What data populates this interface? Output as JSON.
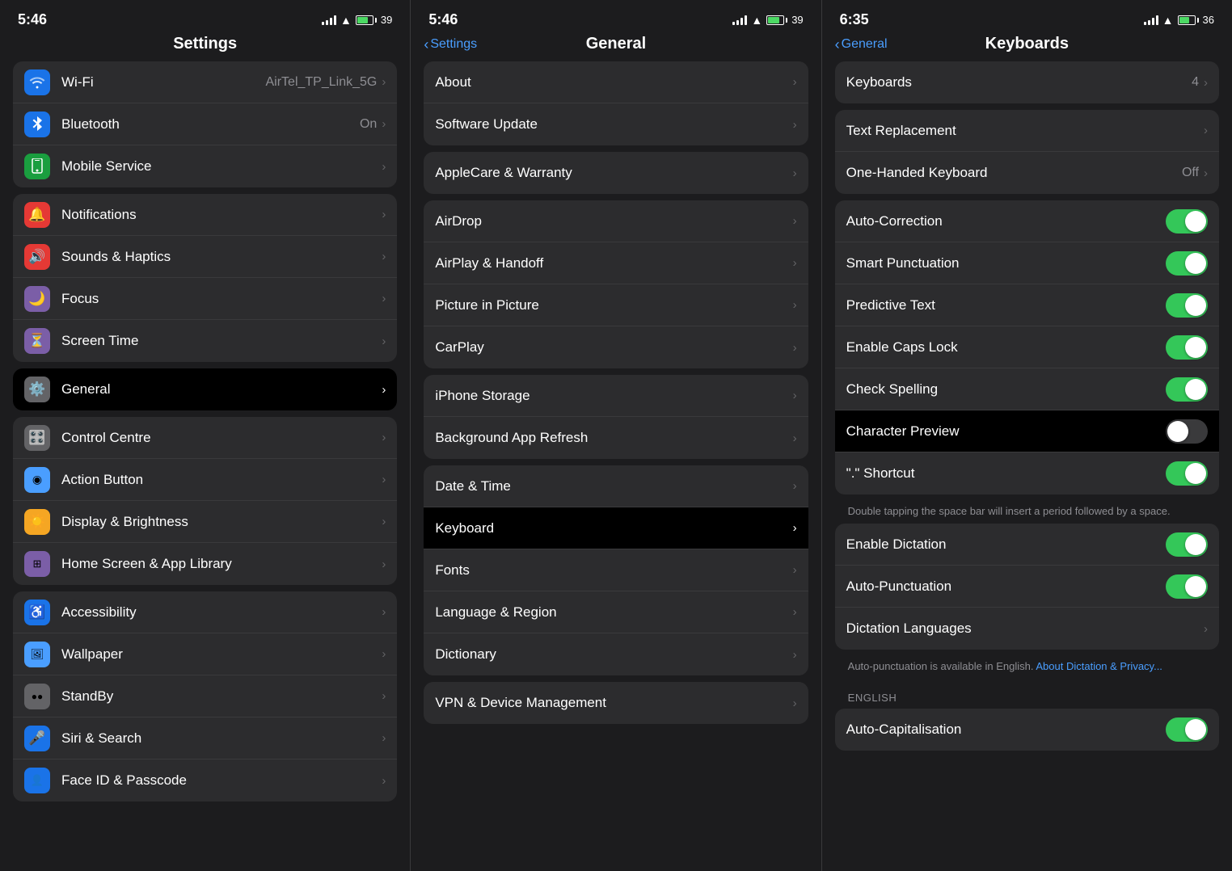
{
  "panel1": {
    "statusTime": "5:46",
    "title": "Settings",
    "rows": [
      {
        "id": "wifi",
        "icon": "📶",
        "iconBg": "#1a73e8",
        "label": "Wi-Fi",
        "value": "AirTel_TP_Link_5G",
        "chevron": true
      },
      {
        "id": "bluetooth",
        "icon": "🔵",
        "iconBg": "#1a73e8",
        "label": "Bluetooth",
        "value": "On",
        "chevron": true
      },
      {
        "id": "mobile",
        "icon": "📱",
        "iconBg": "#1a9e3f",
        "label": "Mobile Service",
        "value": "",
        "chevron": true
      },
      {
        "id": "notifications",
        "icon": "🔔",
        "iconBg": "#e53935",
        "label": "Notifications",
        "value": "",
        "chevron": true
      },
      {
        "id": "sounds",
        "icon": "🔊",
        "iconBg": "#e53935",
        "label": "Sounds & Haptics",
        "value": "",
        "chevron": true
      },
      {
        "id": "focus",
        "icon": "🌙",
        "iconBg": "#7b5ea7",
        "label": "Focus",
        "value": "",
        "chevron": true
      },
      {
        "id": "screentime",
        "icon": "⏳",
        "iconBg": "#7b5ea7",
        "label": "Screen Time",
        "value": "",
        "chevron": true
      },
      {
        "id": "general",
        "icon": "⚙️",
        "iconBg": "#636366",
        "label": "General",
        "value": "",
        "chevron": true,
        "selected": true
      },
      {
        "id": "controlcentre",
        "icon": "🎛️",
        "iconBg": "#636366",
        "label": "Control Centre",
        "value": "",
        "chevron": true
      },
      {
        "id": "actionbutton",
        "icon": "🔘",
        "iconBg": "#4a9eff",
        "label": "Action Button",
        "value": "",
        "chevron": true
      },
      {
        "id": "display",
        "icon": "☀️",
        "iconBg": "#f5a623",
        "label": "Display & Brightness",
        "value": "",
        "chevron": true
      },
      {
        "id": "homescreen",
        "icon": "📱",
        "iconBg": "#7b5ea7",
        "label": "Home Screen & App Library",
        "value": "",
        "chevron": true
      },
      {
        "id": "accessibility",
        "icon": "♿",
        "iconBg": "#1a73e8",
        "label": "Accessibility",
        "value": "",
        "chevron": true
      },
      {
        "id": "wallpaper",
        "icon": "🖼️",
        "iconBg": "#4a9eff",
        "label": "Wallpaper",
        "value": "",
        "chevron": true
      },
      {
        "id": "standby",
        "icon": "🌙",
        "iconBg": "#636366",
        "label": "StandBy",
        "value": "",
        "chevron": true
      },
      {
        "id": "siri",
        "icon": "🎤",
        "iconBg": "#1a73e8",
        "label": "Siri & Search",
        "value": "",
        "chevron": true
      },
      {
        "id": "faceid",
        "icon": "👤",
        "iconBg": "#1a73e8",
        "label": "Face ID & Passcode",
        "value": "",
        "chevron": true
      }
    ]
  },
  "panel2": {
    "statusTime": "5:46",
    "backLabel": "Settings",
    "title": "General",
    "sections": [
      {
        "rows": [
          {
            "id": "about",
            "label": "About",
            "chevron": true
          },
          {
            "id": "softwareupdate",
            "label": "Software Update",
            "chevron": true
          }
        ]
      },
      {
        "rows": [
          {
            "id": "applecare",
            "label": "AppleCare & Warranty",
            "chevron": true
          }
        ]
      },
      {
        "rows": [
          {
            "id": "airdrop",
            "label": "AirDrop",
            "chevron": true
          },
          {
            "id": "airplay",
            "label": "AirPlay & Handoff",
            "chevron": true
          },
          {
            "id": "pictureinpicture",
            "label": "Picture in Picture",
            "chevron": true
          },
          {
            "id": "carplay",
            "label": "CarPlay",
            "chevron": true
          }
        ]
      },
      {
        "rows": [
          {
            "id": "iphonestorage",
            "label": "iPhone Storage",
            "chevron": true
          },
          {
            "id": "backgroundapprefresh",
            "label": "Background App Refresh",
            "chevron": true
          }
        ]
      },
      {
        "rows": [
          {
            "id": "datetime",
            "label": "Date & Time",
            "chevron": true
          },
          {
            "id": "keyboard",
            "label": "Keyboard",
            "chevron": true,
            "selected": true
          },
          {
            "id": "fonts",
            "label": "Fonts",
            "chevron": true
          },
          {
            "id": "languageregion",
            "label": "Language & Region",
            "chevron": true
          },
          {
            "id": "dictionary",
            "label": "Dictionary",
            "chevron": true
          }
        ]
      },
      {
        "rows": [
          {
            "id": "vpn",
            "label": "VPN & Device Management",
            "chevron": true
          }
        ]
      }
    ]
  },
  "panel3": {
    "statusTime": "6:35",
    "backLabel": "General",
    "title": "Keyboards",
    "sections": [
      {
        "rows": [
          {
            "id": "keyboards",
            "label": "Keyboards",
            "value": "4",
            "chevron": true
          }
        ]
      },
      {
        "rows": [
          {
            "id": "textreplacement",
            "label": "Text Replacement",
            "chevron": true
          },
          {
            "id": "onehandedkeyboard",
            "label": "One-Handed Keyboard",
            "value": "Off",
            "chevron": true
          }
        ]
      },
      {
        "rows": [
          {
            "id": "autocorrection",
            "label": "Auto-Correction",
            "toggle": true,
            "toggleOn": true
          },
          {
            "id": "smartpunctuation",
            "label": "Smart Punctuation",
            "toggle": true,
            "toggleOn": true
          },
          {
            "id": "predictivetext",
            "label": "Predictive Text",
            "toggle": true,
            "toggleOn": true
          },
          {
            "id": "enablecapslock",
            "label": "Enable Caps Lock",
            "toggle": true,
            "toggleOn": true
          },
          {
            "id": "checkspelling",
            "label": "Check Spelling",
            "toggle": true,
            "toggleOn": true
          },
          {
            "id": "characterpreview",
            "label": "Character Preview",
            "toggle": true,
            "toggleOn": false,
            "selected": true
          },
          {
            "id": "periodshortcut",
            "label": "\"\" Shortcut",
            "toggle": true,
            "toggleOn": true
          }
        ]
      },
      {
        "sublabel": "Double tapping the space bar will insert a period followed by a space."
      },
      {
        "rows": [
          {
            "id": "enabledictation",
            "label": "Enable Dictation",
            "toggle": true,
            "toggleOn": true
          },
          {
            "id": "autopunctuation",
            "label": "Auto-Punctuation",
            "toggle": true,
            "toggleOn": true
          },
          {
            "id": "dictationlanguages",
            "label": "Dictation Languages",
            "chevron": true
          }
        ]
      },
      {
        "sublabel": "Auto-punctuation is available in English. About Dictation & Privacy...",
        "sublabelLink": "About Dictation & Privacy..."
      },
      {
        "sectionHeader": "ENGLISH"
      },
      {
        "rows": [
          {
            "id": "autocapitalization",
            "label": "Auto-Capitalisation",
            "toggle": true,
            "toggleOn": true
          }
        ]
      }
    ]
  }
}
